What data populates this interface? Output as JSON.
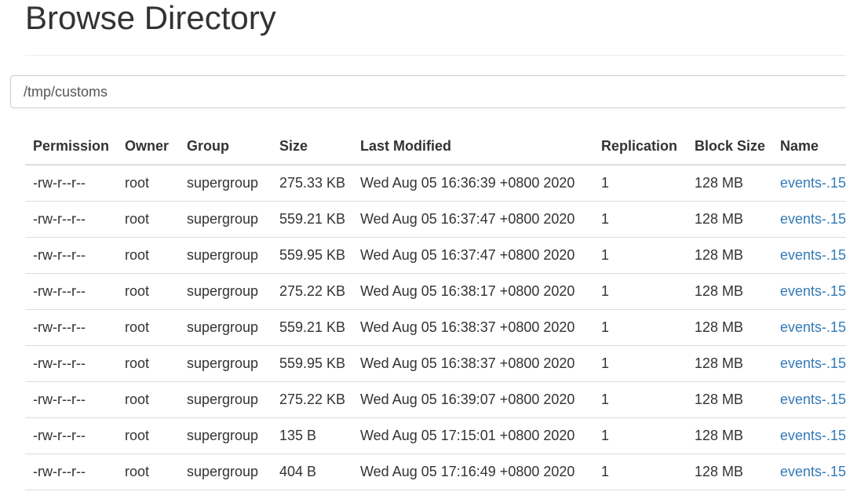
{
  "page": {
    "title": "Browse Directory"
  },
  "path_bar": {
    "value": "/tmp/customs"
  },
  "table": {
    "headers": {
      "permission": "Permission",
      "owner": "Owner",
      "group": "Group",
      "size": "Size",
      "last_modified": "Last Modified",
      "replication": "Replication",
      "block_size": "Block Size",
      "name": "Name"
    },
    "rows": [
      {
        "permission": "-rw-r--r--",
        "owner": "root",
        "group": "supergroup",
        "size": "275.33 KB",
        "last_modified": "Wed Aug 05 16:36:39 +0800 2020",
        "replication": "1",
        "block_size": "128 MB",
        "name": "events-.15"
      },
      {
        "permission": "-rw-r--r--",
        "owner": "root",
        "group": "supergroup",
        "size": "559.21 KB",
        "last_modified": "Wed Aug 05 16:37:47 +0800 2020",
        "replication": "1",
        "block_size": "128 MB",
        "name": "events-.15"
      },
      {
        "permission": "-rw-r--r--",
        "owner": "root",
        "group": "supergroup",
        "size": "559.95 KB",
        "last_modified": "Wed Aug 05 16:37:47 +0800 2020",
        "replication": "1",
        "block_size": "128 MB",
        "name": "events-.15"
      },
      {
        "permission": "-rw-r--r--",
        "owner": "root",
        "group": "supergroup",
        "size": "275.22 KB",
        "last_modified": "Wed Aug 05 16:38:17 +0800 2020",
        "replication": "1",
        "block_size": "128 MB",
        "name": "events-.15"
      },
      {
        "permission": "-rw-r--r--",
        "owner": "root",
        "group": "supergroup",
        "size": "559.21 KB",
        "last_modified": "Wed Aug 05 16:38:37 +0800 2020",
        "replication": "1",
        "block_size": "128 MB",
        "name": "events-.15"
      },
      {
        "permission": "-rw-r--r--",
        "owner": "root",
        "group": "supergroup",
        "size": "559.95 KB",
        "last_modified": "Wed Aug 05 16:38:37 +0800 2020",
        "replication": "1",
        "block_size": "128 MB",
        "name": "events-.15"
      },
      {
        "permission": "-rw-r--r--",
        "owner": "root",
        "group": "supergroup",
        "size": "275.22 KB",
        "last_modified": "Wed Aug 05 16:39:07 +0800 2020",
        "replication": "1",
        "block_size": "128 MB",
        "name": "events-.15"
      },
      {
        "permission": "-rw-r--r--",
        "owner": "root",
        "group": "supergroup",
        "size": "135 B",
        "last_modified": "Wed Aug 05 17:15:01 +0800 2020",
        "replication": "1",
        "block_size": "128 MB",
        "name": "events-.15"
      },
      {
        "permission": "-rw-r--r--",
        "owner": "root",
        "group": "supergroup",
        "size": "404 B",
        "last_modified": "Wed Aug 05 17:16:49 +0800 2020",
        "replication": "1",
        "block_size": "128 MB",
        "name": "events-.15"
      }
    ]
  },
  "colors": {
    "text": "#333333",
    "link": "#337ab7",
    "border": "#dddddd",
    "input_border": "#cccccc"
  }
}
